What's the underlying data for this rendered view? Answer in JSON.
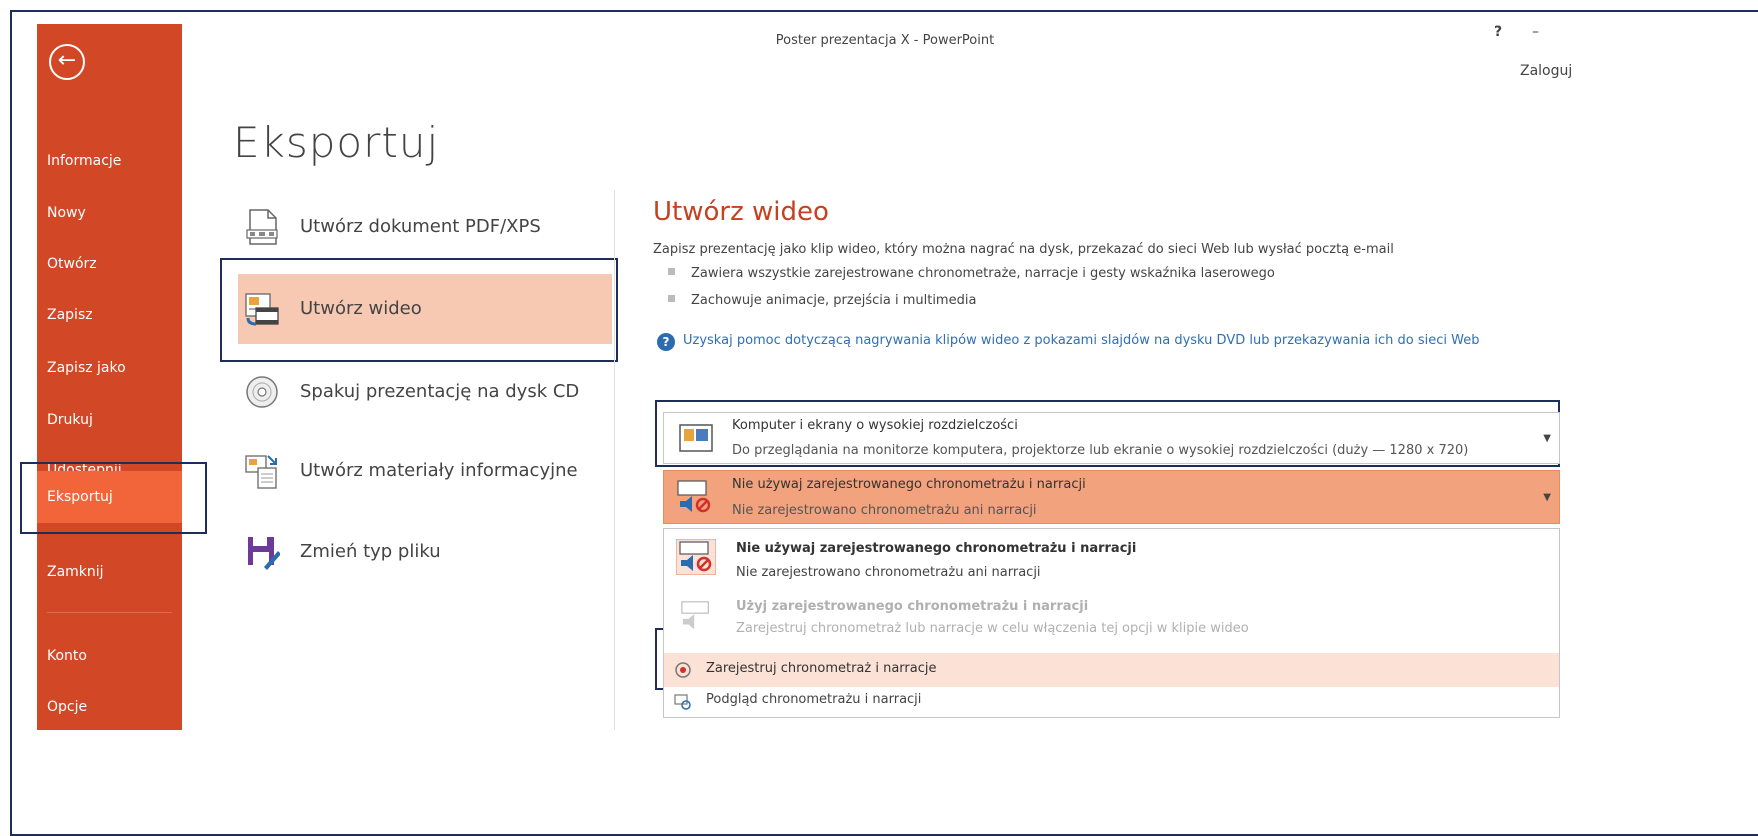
{
  "window": {
    "title": "Poster prezentacja X - PowerPoint",
    "help": "?",
    "minimize": "–",
    "sign_in": "Zaloguj"
  },
  "sidebar": {
    "back_icon": "back-arrow-icon",
    "items": [
      {
        "label": "Informacje"
      },
      {
        "label": "Nowy"
      },
      {
        "label": "Otwórz"
      },
      {
        "label": "Zapisz"
      },
      {
        "label": "Zapisz jako"
      },
      {
        "label": "Drukuj"
      },
      {
        "label": "Udostępnij"
      },
      {
        "label": "Eksportuj",
        "active": true
      },
      {
        "label": "Zamknij"
      },
      {
        "label": "Konto"
      },
      {
        "label": "Opcje"
      }
    ],
    "colors": {
      "background": "#d24726",
      "active": "#f2643a"
    }
  },
  "page": {
    "title": "Eksportuj"
  },
  "export_options": [
    {
      "label": "Utwórz dokument PDF/XPS",
      "icon": "pdf-document-icon"
    },
    {
      "label": "Utwórz wideo",
      "icon": "video-icon",
      "selected": true
    },
    {
      "label": "Spakuj prezentację na dysk CD",
      "icon": "cd-icon"
    },
    {
      "label": "Utwórz materiały informacyjne",
      "icon": "handouts-icon"
    },
    {
      "label": "Zmień typ pliku",
      "icon": "save-as-type-icon"
    }
  ],
  "video_panel": {
    "title": "Utwórz wideo",
    "description": "Zapisz prezentację jako klip wideo, który można nagrać na dysk, przekazać do sieci Web lub wysłać pocztą e-mail",
    "bullets": [
      "Zawiera wszystkie zarejestrowane chronometraże, narracje i gesty wskaźnika laserowego",
      "Zachowuje animacje, przejścia i multimedia"
    ],
    "help_link": "Uzyskaj pomoc dotyczącą nagrywania klipów wideo z pokazami slajdów na dysku DVD lub przekazywania ich do sieci Web",
    "quality_dropdown": {
      "title": "Komputer i ekrany o wysokiej rozdzielczości",
      "subtitle": "Do przeglądania na monitorze komputera, projektorze lub ekranie o wysokiej rozdzielczości (duży — 1280 x 720)"
    },
    "timing_dropdown": {
      "title": "Nie używaj zarejestrowanego chronometrażu i narracji",
      "subtitle": "Nie zarejestrowano chronometrażu ani narracji"
    },
    "timing_options": [
      {
        "title": "Nie używaj zarejestrowanego chronometrażu i narracji",
        "subtitle": "Nie zarejestrowano chronometrażu ani narracji"
      },
      {
        "title": "Użyj zarejestrowanego chronometrażu i narracji",
        "subtitle": "Zarejestruj chronometraż lub narracje w celu włączenia tej opcji w klipie wideo",
        "disabled": true
      },
      {
        "title": "Zarejestruj chronometraż i narracje",
        "icon": "record-icon"
      },
      {
        "title": "Podgląd chronometrażu i narracji",
        "icon": "preview-icon"
      }
    ],
    "accent_color": "#c5411f"
  }
}
